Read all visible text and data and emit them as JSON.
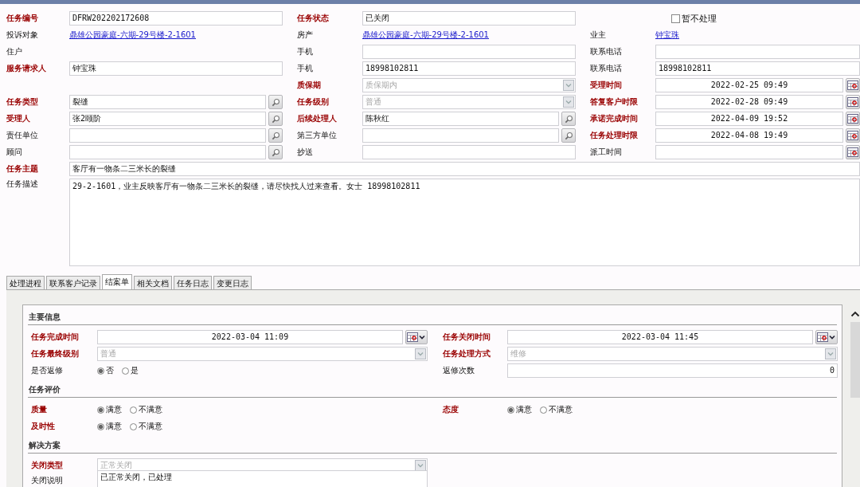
{
  "form": {
    "rows": [
      {
        "cells": [
          {
            "label": "任务编号",
            "required": true,
            "kind": "text",
            "value": "DFRW202202172608"
          },
          {
            "label": "任务状态",
            "required": true,
            "kind": "text",
            "value": "已关闭"
          },
          {
            "kind": "checkbox",
            "value": "暂不处理",
            "checked": false
          }
        ]
      },
      {
        "cells": [
          {
            "label": "投诉对象",
            "required": false,
            "kind": "link",
            "value": "鼎雄公园豪庭-六期-29号楼-2-1601"
          },
          {
            "label": "房产",
            "required": false,
            "kind": "link",
            "value": "鼎雄公园豪庭-六期-29号楼-2-1601"
          },
          {
            "label": "业主",
            "required": false,
            "kind": "link",
            "value": "钟宝珠"
          }
        ]
      },
      {
        "cells": [
          {
            "label": "住户",
            "required": false,
            "kind": "none"
          },
          {
            "label": "手机",
            "required": false,
            "kind": "text"
          },
          {
            "label": "联系电话",
            "required": false,
            "kind": "text"
          }
        ]
      },
      {
        "cells": [
          {
            "label": "服务请求人",
            "required": true,
            "kind": "text",
            "value": "钟宝珠"
          },
          {
            "label": "手机",
            "required": false,
            "kind": "text",
            "value": "18998102811"
          },
          {
            "label": "联系电话",
            "required": false,
            "kind": "text",
            "value": "18998102811"
          }
        ]
      },
      {
        "cells": [
          {
            "kind": "blank"
          },
          {
            "label": "质保期",
            "required": true,
            "kind": "select",
            "value": "质保期内",
            "disabled": true
          },
          {
            "label": "受理时间",
            "required": true,
            "kind": "date",
            "value": "2022-02-25 09:49"
          }
        ]
      },
      {
        "cells": [
          {
            "label": "任务类型",
            "required": true,
            "kind": "lookup",
            "value": "裂缝"
          },
          {
            "label": "任务级别",
            "required": true,
            "kind": "select",
            "value": "普通",
            "disabled": true
          },
          {
            "label": "答复客户时限",
            "required": true,
            "kind": "date",
            "value": "2022-02-28 09:49"
          }
        ]
      },
      {
        "cells": [
          {
            "label": "受理人",
            "required": true,
            "kind": "lookup",
            "value": "张2颐阶"
          },
          {
            "label": "后续处理人",
            "required": true,
            "kind": "lookup",
            "value": "陈秋红"
          },
          {
            "label": "承诺完成时间",
            "required": true,
            "kind": "date",
            "value": "2022-04-09 19:52"
          }
        ]
      },
      {
        "cells": [
          {
            "label": "责任单位",
            "required": false,
            "kind": "lookup"
          },
          {
            "label": "第三方单位",
            "required": false,
            "kind": "lookup"
          },
          {
            "label": "任务处理时限",
            "required": true,
            "kind": "date",
            "value": "2022-04-08 19:49"
          }
        ]
      },
      {
        "cells": [
          {
            "label": "顾问",
            "required": false,
            "kind": "lookup"
          },
          {
            "label": "抄送",
            "required": false,
            "kind": "text"
          },
          {
            "label": "派工时间",
            "required": false,
            "kind": "date"
          }
        ]
      }
    ],
    "subject": {
      "label": "任务主题",
      "required": true,
      "value": "客厅有一物条二三米长的裂缝"
    },
    "description": {
      "label": "任务描述",
      "required": false,
      "value": "29-2-1601，业主反映客厅有一物条二三米长的裂缝，请尽快找人过来查看。女士 18998102811"
    }
  },
  "tabs": [
    {
      "label": "处理进程",
      "selected": false
    },
    {
      "label": "联系客户记录",
      "selected": false
    },
    {
      "label": "结案单",
      "selected": true
    },
    {
      "label": "相关文档",
      "selected": false
    },
    {
      "label": "任务日志",
      "selected": false
    },
    {
      "label": "变更日志",
      "selected": false
    }
  ],
  "closure": {
    "sections": [
      {
        "title": "主要信息",
        "rows": [
          {
            "cells": [
              {
                "label": "任务完成时间",
                "required": true,
                "kind": "date",
                "value": "2022-03-04 11:09"
              },
              {
                "label": "任务关闭时间",
                "required": true,
                "kind": "date",
                "value": "2022-03-04 11:45"
              }
            ]
          },
          {
            "cells": [
              {
                "label": "任务最终级别",
                "required": true,
                "kind": "select",
                "value": "普通",
                "disabled": true
              },
              {
                "label": "任务处理方式",
                "required": true,
                "kind": "select",
                "value": "维修",
                "disabled": true
              }
            ]
          },
          {
            "cells": [
              {
                "label": "是否返修",
                "required": false,
                "kind": "radio",
                "options": [
                  {
                    "label": "否",
                    "selected": true
                  },
                  {
                    "label": "是",
                    "selected": false
                  }
                ]
              },
              {
                "label": "返修次数",
                "required": false,
                "kind": "number",
                "value": "0"
              }
            ]
          }
        ]
      },
      {
        "title": "任务评价",
        "rows": [
          {
            "cells": [
              {
                "label": "质量",
                "required": true,
                "kind": "radio",
                "options": [
                  {
                    "label": "满意",
                    "selected": true
                  },
                  {
                    "label": "不满意",
                    "selected": false
                  }
                ]
              },
              {
                "label": "态度",
                "required": true,
                "kind": "radio",
                "options": [
                  {
                    "label": "满意",
                    "selected": true
                  },
                  {
                    "label": "不满意",
                    "selected": false
                  }
                ]
              }
            ]
          },
          {
            "cells": [
              {
                "label": "及时性",
                "required": true,
                "kind": "radio",
                "options": [
                  {
                    "label": "满意",
                    "selected": true
                  },
                  {
                    "label": "不满意",
                    "selected": false
                  }
                ]
              }
            ]
          }
        ]
      },
      {
        "title": "解决方案",
        "rows": [
          {
            "cells": [
              {
                "label": "关闭类型",
                "required": true,
                "kind": "select",
                "value": "正常关闭",
                "disabled": true
              }
            ]
          },
          {
            "cells": [
              {
                "label": "关闭说明",
                "required": false,
                "kind": "textarea",
                "value": "已正常关闭，已处理"
              }
            ]
          }
        ]
      }
    ]
  }
}
